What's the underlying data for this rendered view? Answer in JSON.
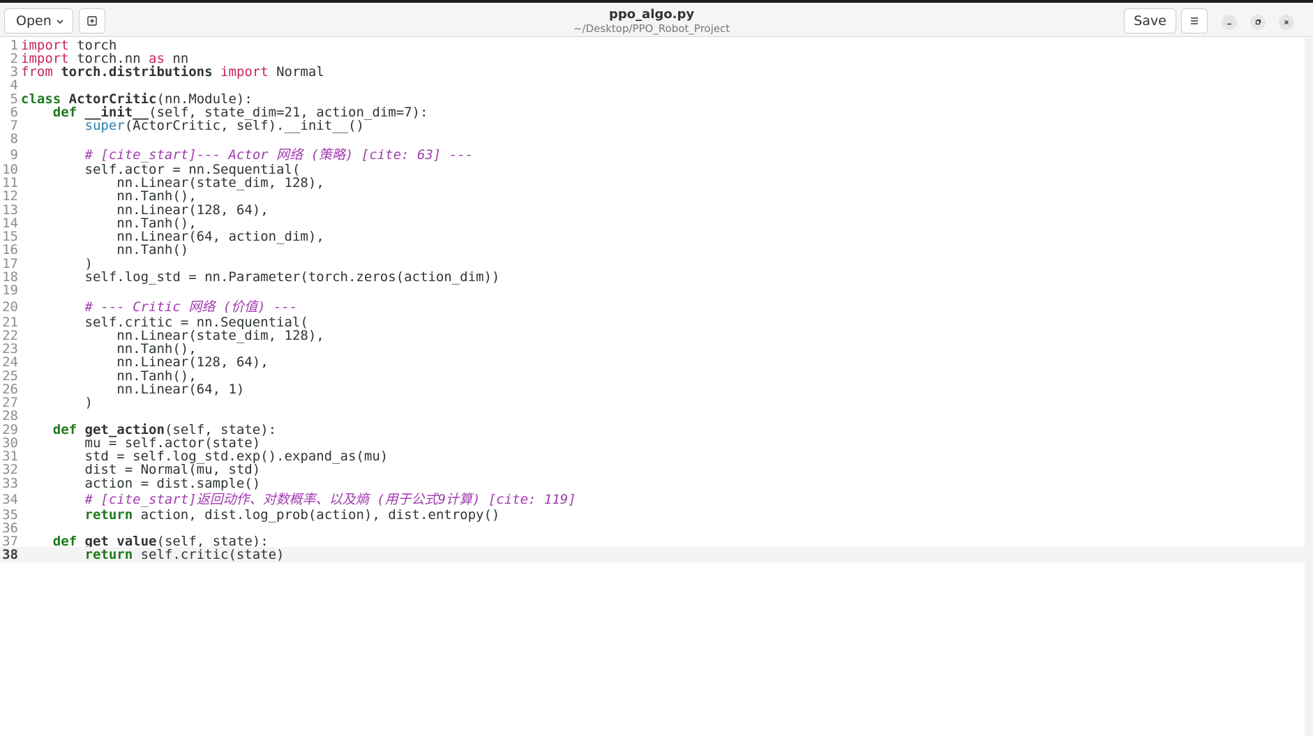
{
  "header": {
    "open_label": "Open",
    "title": "ppo_algo.py",
    "subtitle": "~/Desktop/PPO_Robot_Project",
    "save_label": "Save",
    "icons": {
      "open_dropdown": "chevron-down-icon",
      "new_tab": "new-tab-icon",
      "menu": "hamburger-menu-icon",
      "minimize": "minimize-icon",
      "maximize": "maximize-icon",
      "close": "close-icon"
    }
  },
  "editor": {
    "current_line": 38,
    "colors": {
      "keyword": "#c7255e",
      "def_keyword": "#1e7a1e",
      "builtin": "#2a83a8",
      "comment": "#a23bb0",
      "text": "#2e3436"
    },
    "lines": [
      {
        "n": "1",
        "t": [
          [
            "kw",
            "import"
          ],
          [
            "p",
            " torch"
          ]
        ]
      },
      {
        "n": "2",
        "t": [
          [
            "kw",
            "import"
          ],
          [
            "p",
            " torch.nn "
          ],
          [
            "kw",
            "as"
          ],
          [
            "p",
            " nn"
          ]
        ]
      },
      {
        "n": "3",
        "t": [
          [
            "kw",
            "from"
          ],
          [
            "p",
            " "
          ],
          [
            "mod",
            "torch.distributions"
          ],
          [
            "p",
            " "
          ],
          [
            "kw",
            "import"
          ],
          [
            "p",
            " Normal"
          ]
        ]
      },
      {
        "n": "4",
        "t": []
      },
      {
        "n": "5",
        "t": [
          [
            "kwb",
            "class"
          ],
          [
            "p",
            " "
          ],
          [
            "fn",
            "ActorCritic"
          ],
          [
            "p",
            "(nn.Module):"
          ]
        ]
      },
      {
        "n": "6",
        "t": [
          [
            "p",
            "    "
          ],
          [
            "kwb",
            "def"
          ],
          [
            "p",
            " "
          ],
          [
            "dn",
            "__init__"
          ],
          [
            "p",
            "(self, state_dim=21, action_dim=7):"
          ]
        ]
      },
      {
        "n": "7",
        "t": [
          [
            "p",
            "        "
          ],
          [
            "bi",
            "super"
          ],
          [
            "p",
            "(ActorCritic, self).__init__()"
          ]
        ]
      },
      {
        "n": "8",
        "t": []
      },
      {
        "n": "9",
        "t": [
          [
            "p",
            "        "
          ],
          [
            "cm",
            "# [cite_start]--- Actor 网络 (策略) [cite: 63] ---"
          ]
        ]
      },
      {
        "n": "10",
        "t": [
          [
            "p",
            "        self.actor = nn.Sequential("
          ]
        ]
      },
      {
        "n": "11",
        "t": [
          [
            "p",
            "            nn.Linear(state_dim, "
          ],
          [
            "num",
            "128"
          ],
          [
            "p",
            "),"
          ]
        ]
      },
      {
        "n": "12",
        "t": [
          [
            "p",
            "            nn.Tanh(),"
          ]
        ]
      },
      {
        "n": "13",
        "t": [
          [
            "p",
            "            nn.Linear("
          ],
          [
            "num",
            "128"
          ],
          [
            "p",
            ", "
          ],
          [
            "num",
            "64"
          ],
          [
            "p",
            "),"
          ]
        ]
      },
      {
        "n": "14",
        "t": [
          [
            "p",
            "            nn.Tanh(),"
          ]
        ]
      },
      {
        "n": "15",
        "t": [
          [
            "p",
            "            nn.Linear("
          ],
          [
            "num",
            "64"
          ],
          [
            "p",
            ", action_dim),"
          ]
        ]
      },
      {
        "n": "16",
        "t": [
          [
            "p",
            "            nn.Tanh()"
          ]
        ]
      },
      {
        "n": "17",
        "t": [
          [
            "p",
            "        )"
          ]
        ]
      },
      {
        "n": "18",
        "t": [
          [
            "p",
            "        self.log_std = nn.Parameter(torch.zeros(action_dim))"
          ]
        ]
      },
      {
        "n": "19",
        "t": []
      },
      {
        "n": "20",
        "t": [
          [
            "p",
            "        "
          ],
          [
            "cm",
            "# --- Critic 网络 (价值) ---"
          ]
        ]
      },
      {
        "n": "21",
        "t": [
          [
            "p",
            "        self.critic = nn.Sequential("
          ]
        ]
      },
      {
        "n": "22",
        "t": [
          [
            "p",
            "            nn.Linear(state_dim, "
          ],
          [
            "num",
            "128"
          ],
          [
            "p",
            "),"
          ]
        ]
      },
      {
        "n": "23",
        "t": [
          [
            "p",
            "            nn.Tanh(),"
          ]
        ]
      },
      {
        "n": "24",
        "t": [
          [
            "p",
            "            nn.Linear("
          ],
          [
            "num",
            "128"
          ],
          [
            "p",
            ", "
          ],
          [
            "num",
            "64"
          ],
          [
            "p",
            "),"
          ]
        ]
      },
      {
        "n": "25",
        "t": [
          [
            "p",
            "            nn.Tanh(),"
          ]
        ]
      },
      {
        "n": "26",
        "t": [
          [
            "p",
            "            nn.Linear("
          ],
          [
            "num",
            "64"
          ],
          [
            "p",
            ", "
          ],
          [
            "num",
            "1"
          ],
          [
            "p",
            ")"
          ]
        ]
      },
      {
        "n": "27",
        "t": [
          [
            "p",
            "        )"
          ]
        ]
      },
      {
        "n": "28",
        "t": []
      },
      {
        "n": "29",
        "t": [
          [
            "p",
            "    "
          ],
          [
            "kwb",
            "def"
          ],
          [
            "p",
            " "
          ],
          [
            "fn",
            "get_action"
          ],
          [
            "p",
            "(self, state):"
          ]
        ]
      },
      {
        "n": "30",
        "t": [
          [
            "p",
            "        mu = self.actor(state)"
          ]
        ]
      },
      {
        "n": "31",
        "t": [
          [
            "p",
            "        std = self.log_std.exp().expand_as(mu)"
          ]
        ]
      },
      {
        "n": "32",
        "t": [
          [
            "p",
            "        dist = Normal(mu, std)"
          ]
        ]
      },
      {
        "n": "33",
        "t": [
          [
            "p",
            "        action = dist.sample()"
          ]
        ]
      },
      {
        "n": "34",
        "t": [
          [
            "p",
            "        "
          ],
          [
            "cm",
            "# [cite_start]返回动作、对数概率、以及熵 (用于公式9计算) [cite: 119]"
          ]
        ]
      },
      {
        "n": "35",
        "t": [
          [
            "p",
            "        "
          ],
          [
            "kwb",
            "return"
          ],
          [
            "p",
            " action, dist.log_prob(action), dist.entropy()"
          ]
        ]
      },
      {
        "n": "36",
        "t": []
      },
      {
        "n": "37",
        "t": [
          [
            "p",
            "    "
          ],
          [
            "kwb",
            "def"
          ],
          [
            "p",
            " "
          ],
          [
            "fn",
            "get_value"
          ],
          [
            "p",
            "(self, state):"
          ]
        ]
      },
      {
        "n": "38",
        "t": [
          [
            "p",
            "        "
          ],
          [
            "kwb",
            "return"
          ],
          [
            "p",
            " self.critic(state)"
          ]
        ]
      }
    ]
  }
}
